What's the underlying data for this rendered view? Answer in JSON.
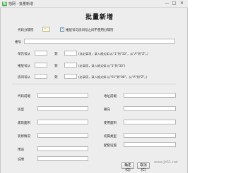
{
  "window": {
    "app_icon": "拍",
    "title": "拍网 - 批量新增",
    "min_icon": "—",
    "max_icon": "□",
    "close_icon": "✕"
  },
  "page_title": "批量新增",
  "code_separator": {
    "label": "代码分隔符",
    "value": "-",
    "checkbox_checked": true,
    "checkbox_label": "楼层号与房间号之间不使用分隔符"
  },
  "building_no": {
    "label": "楼号",
    "value": ""
  },
  "unit_range": {
    "from_label": "单元号从",
    "to_label": "到",
    "from": "",
    "to": "",
    "note": "(非必录项，录入格式如:从\"1\"到\"10\"，从\"A\"到\"Z\"。)"
  },
  "floor_range": {
    "from_label": "楼层号从",
    "to_label": "到",
    "from": "",
    "to": "",
    "note": "(必录项，录入格式如:从\"1\"到\"30\")"
  },
  "room_range": {
    "from_label": "房间号从",
    "to_label": "到",
    "from": "",
    "to": "",
    "note": "(必录项，录入格式如:从\"01\"到\"08\"，从\"A\"到\"Z\"。)"
  },
  "fields_left": [
    {
      "label": "代码前缀",
      "value": ""
    },
    {
      "label": "房型",
      "value": ""
    },
    {
      "label": "建筑面积",
      "value": ""
    },
    {
      "label": "装修情况",
      "value": ""
    },
    {
      "label": "用途",
      "value": ""
    },
    {
      "label": "说明",
      "value": ""
    }
  ],
  "fields_right": [
    {
      "label": "地址前缀",
      "value": ""
    },
    {
      "label": "朝向",
      "value": ""
    },
    {
      "label": "使用面积",
      "value": ""
    },
    {
      "label": "权属类型",
      "value": ""
    },
    {
      "label": "配套设施",
      "value": ""
    }
  ],
  "buttons": {
    "ok": "确定(Q)",
    "cancel": "取消(C)"
  },
  "watermark": "www.jb51.net"
}
